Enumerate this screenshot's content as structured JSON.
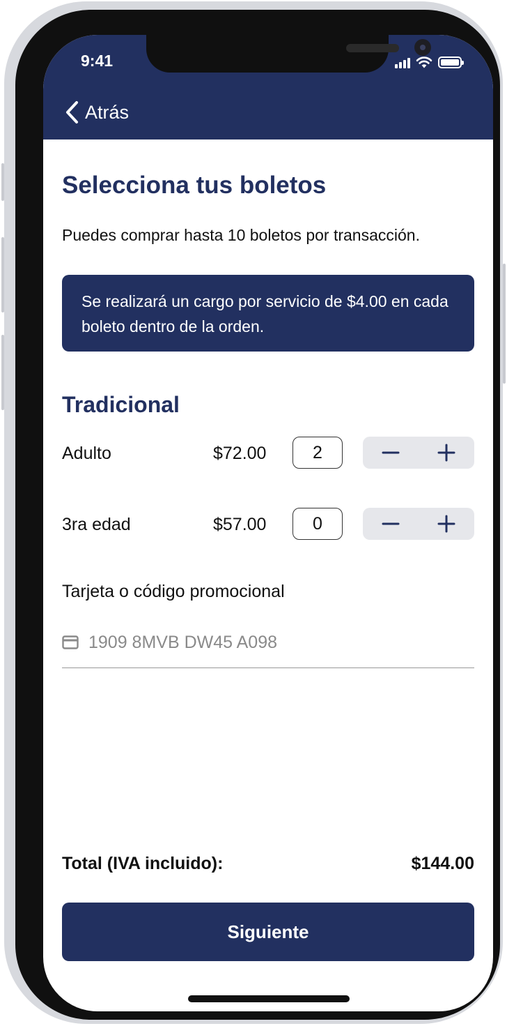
{
  "status_bar": {
    "time": "9:41"
  },
  "nav": {
    "back_label": "Atrás"
  },
  "page": {
    "title": "Selecciona tus boletos",
    "subtitle": "Puedes comprar hasta 10 boletos por transacción.",
    "notice": "Se realizará un cargo por servicio de $4.00 en cada boleto dentro de la orden."
  },
  "section": {
    "title": "Tradicional",
    "tickets": [
      {
        "label": "Adulto",
        "price": "$72.00",
        "quantity": "2"
      },
      {
        "label": "3ra edad",
        "price": "$57.00",
        "quantity": "0"
      }
    ]
  },
  "promo": {
    "label": "Tarjeta o código promocional",
    "placeholder": "1909 8MVB DW45 A098"
  },
  "summary": {
    "total_label": "Total (IVA incluido):",
    "total_value": "$144.00"
  },
  "actions": {
    "next_label": "Siguiente"
  },
  "colors": {
    "primary": "#223060",
    "stepper_bg": "#e6e7eb"
  },
  "icons": {
    "back": "chevron-left-icon",
    "minus": "minus-icon",
    "plus": "plus-icon",
    "card": "credit-card-icon"
  }
}
